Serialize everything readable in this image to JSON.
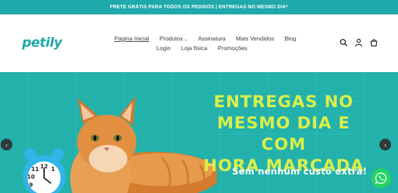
{
  "announcement": {
    "text": "FRETE GRÁTIS PARA TODOS OS PEDIDOS | ENTREGAS NO MESMO DIA*"
  },
  "header": {
    "logo_text": "petily",
    "nav_row1": [
      {
        "label": "Página Inicial",
        "active": true
      },
      {
        "label": "Produtos",
        "has_dropdown": true
      },
      {
        "label": "Assinatura"
      },
      {
        "label": "Mais Vendidos"
      },
      {
        "label": "Blog"
      }
    ],
    "nav_row2": [
      {
        "label": "Login"
      },
      {
        "label": "Loja física"
      },
      {
        "label": "Promoções"
      }
    ],
    "icons": [
      "search-icon",
      "user-icon",
      "cart-icon"
    ]
  },
  "hero": {
    "title_lines": [
      "ENTREGAS NO",
      "MESMO DIA E COM",
      "HORA MARCADA"
    ],
    "subtitle": "Sem nenhum custo extra!",
    "prev_label": "‹",
    "next_label": "›"
  },
  "colors": {
    "brand": "#1fa9ab",
    "hero_bg": "#23b1ab",
    "headline": "#d9ef4a",
    "whatsapp": "#25d366"
  }
}
